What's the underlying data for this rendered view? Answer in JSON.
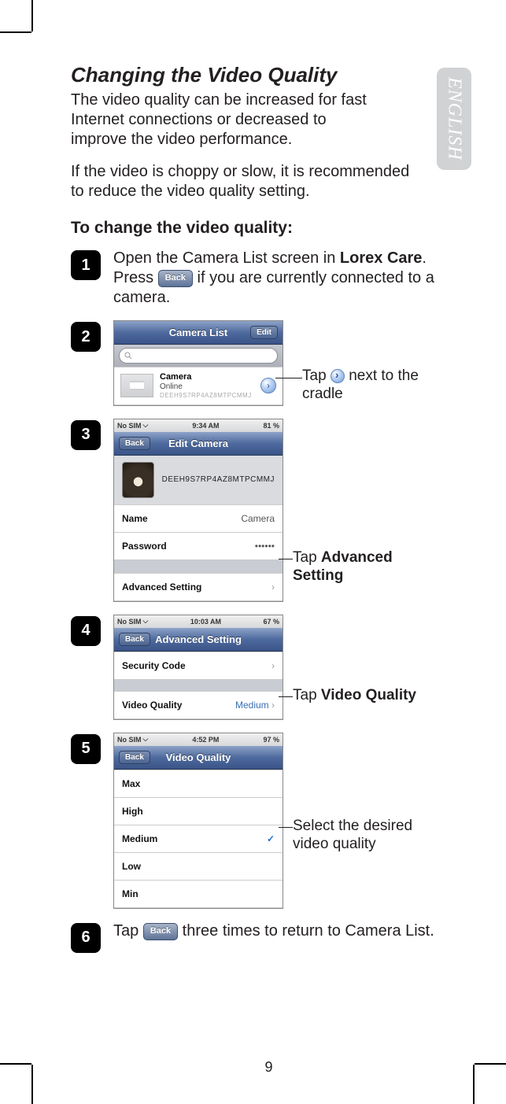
{
  "language_tab": "ENGLISH",
  "title": "Changing the Video Quality",
  "intro1": "The video quality can be increased for fast Internet connections or decreased to improve the video performance.",
  "intro2": "If the video is choppy or slow, it is recommended to reduce the video quality setting.",
  "subhead": "To change the video quality:",
  "page_number": "9",
  "back_label": "Back",
  "steps": {
    "s1": {
      "num": "1",
      "text_a": "Open the Camera List screen in ",
      "text_b": "Lorex Care",
      "text_c": ". Press ",
      "text_d": " if you are currently connected to a camera."
    },
    "s2": {
      "num": "2"
    },
    "s3": {
      "num": "3"
    },
    "s4": {
      "num": "4"
    },
    "s5": {
      "num": "5"
    },
    "s6": {
      "num": "6",
      "text_a": "Tap ",
      "text_b": " three times to return to Camera List."
    }
  },
  "callouts": {
    "c2a": "Tap ",
    "c2b": " next to the cradle",
    "c3a": "Tap ",
    "c3b": "Advanced Setting",
    "c4a": "Tap ",
    "c4b": "Video Quality",
    "c5": "Select the desired video quality"
  },
  "shot2": {
    "nav_title": "Camera List",
    "nav_edit": "Edit",
    "search_placeholder": "",
    "cam_name": "Camera",
    "cam_status": "Online",
    "cam_id": "DEEH9S7RP4AZ8MTPCMMJ"
  },
  "shot3": {
    "status_left": "No SIM",
    "status_time": "9:34 AM",
    "status_batt": "81 %",
    "nav_title": "Edit Camera",
    "nav_back": "Back",
    "cam_id": "DEEH9S7RP4AZ8MTPCMMJ",
    "row_name_label": "Name",
    "row_name_value": "Camera",
    "row_pw_label": "Password",
    "row_pw_value": "••••••",
    "row_adv": "Advanced Setting"
  },
  "shot4": {
    "status_left": "No SIM",
    "status_time": "10:03 AM",
    "status_batt": "67 %",
    "nav_title": "Advanced Setting",
    "nav_back": "Back",
    "row_sec": "Security Code",
    "row_vq_label": "Video Quality",
    "row_vq_value": "Medium"
  },
  "shot5": {
    "status_left": "No SIM",
    "status_time": "4:52 PM",
    "status_batt": "97 %",
    "nav_title": "Video Quality",
    "nav_back": "Back",
    "opts": {
      "o1": "Max",
      "o2": "High",
      "o3": "Medium",
      "o4": "Low",
      "o5": "Min"
    }
  }
}
